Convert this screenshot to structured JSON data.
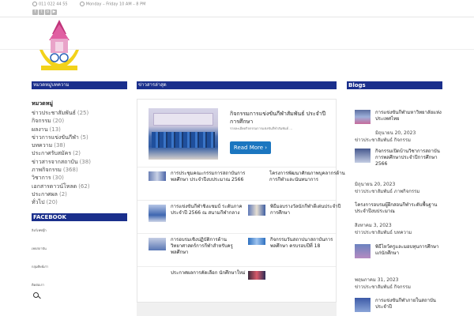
{
  "topbar": {
    "phone": "011 022 44 55",
    "hours": "Monday – Friday 10 AM – 8 PM",
    "social_icons": [
      "facebook-icon",
      "twitter-icon",
      "instagram-icon",
      "youtube-icon"
    ]
  },
  "left": {
    "section_title": "หมวดหมู่บทความ",
    "heading": "หมวดหมู่",
    "categories": [
      {
        "label": "ข่าวประชาสัมพันธ์",
        "count": "(25)"
      },
      {
        "label": "กิจกรรม",
        "count": "(20)"
      },
      {
        "label": "ผลงาน",
        "count": "(13)"
      },
      {
        "label": "ข่าวการแข่งขันกีฬา",
        "count": "(5)"
      },
      {
        "label": "บทความ",
        "count": "(38)"
      },
      {
        "label": "ประกาศรับสมัคร",
        "count": "(2)"
      },
      {
        "label": "ข่าวสารจากสถาบัน",
        "count": "(38)"
      },
      {
        "label": "ภาพกิจกรรม",
        "count": "(368)"
      },
      {
        "label": "วิชาการ",
        "count": "(30)"
      },
      {
        "label": "เอกสารดาวน์โหลด",
        "count": "(62)"
      },
      {
        "label": "ประกาศผล",
        "count": "(2)"
      },
      {
        "label": "ทั่วไป",
        "count": "(20)"
      }
    ],
    "facebook_title": "FACEBOOK",
    "fb_links": [
      "ลิงก์เฟซบุ๊ก",
      "เพจสถาบัน",
      "กลุ่มศิษย์เก่า",
      "ติดต่อเรา"
    ]
  },
  "main": {
    "section_title": "ข่าวสารล่าสุด",
    "featured": {
      "title": "กิจกรรมการแข่งขันกีฬาสัมพันธ์ ประจำปีการศึกษา",
      "excerpt": "รายละเอียดกิจกรรมการแข่งขันกีฬาสัมพันธ์ ...",
      "read_more": "Read More"
    },
    "posts": [
      {
        "title": "การประชุมคณะกรรมการสถาบันการพลศึกษา ประจำปีงบประมาณ 2566"
      },
      {
        "title": "โครงการพัฒนาศักยภาพบุคลากรด้านการกีฬาและนันทนาการ"
      },
      {
        "title": "การแข่งขันกีฬาชิงแชมป์ ระดับภาค ประจำปี 2566 ณ สนามกีฬากลาง"
      },
      {
        "title": "พิธีมอบรางวัลนักกีฬาดีเด่นประจำปีการศึกษา"
      },
      {
        "title": "การอบรมเชิงปฏิบัติการด้านวิทยาศาสตร์การกีฬาสำหรับครูพลศึกษา"
      },
      {
        "title": "กิจกรรมวันสถาปนาสถาบันการพลศึกษา ครบรอบปีที่ 18"
      },
      {
        "title": "ประกาศผลการคัดเลือก นักศึกษาใหม่"
      },
      {
        "title": ""
      }
    ]
  },
  "right": {
    "section_title": "Blogs",
    "blogs": [
      {
        "title": "การแข่งขันกีฬามหาวิทยาลัยแห่งประเทศไทย",
        "date": "มิถุนายน 20, 2023",
        "meta": "ข่าวประชาสัมพันธ์ กิจกรรม"
      },
      {
        "title": "กิจกรรมเปิดบ้านวิชาการสถาบันการพลศึกษาประจำปีการศึกษา 2566",
        "date": "มิถุนายน 20, 2023",
        "meta": "ข่าวประชาสัมพันธ์ ภาพกิจกรรม"
      },
      {
        "title": "โครงการอบรมผู้ฝึกสอนกีฬาระดับพื้นฐาน ประจำปีงบประมาณ",
        "date": "สิงหาคม 3, 2023",
        "meta": "ข่าวประชาสัมพันธ์ บทความ"
      },
      {
        "title": "พิธีไหว้ครูและมอบทุนการศึกษาแก่นักศึกษา",
        "date": "พฤษภาคม 31, 2023",
        "meta": "ข่าวประชาสัมพันธ์ กิจกรรม"
      },
      {
        "title": "การแข่งขันกีฬาภายในสถาบัน ประจำปี",
        "date": "",
        "meta": ""
      }
    ]
  }
}
